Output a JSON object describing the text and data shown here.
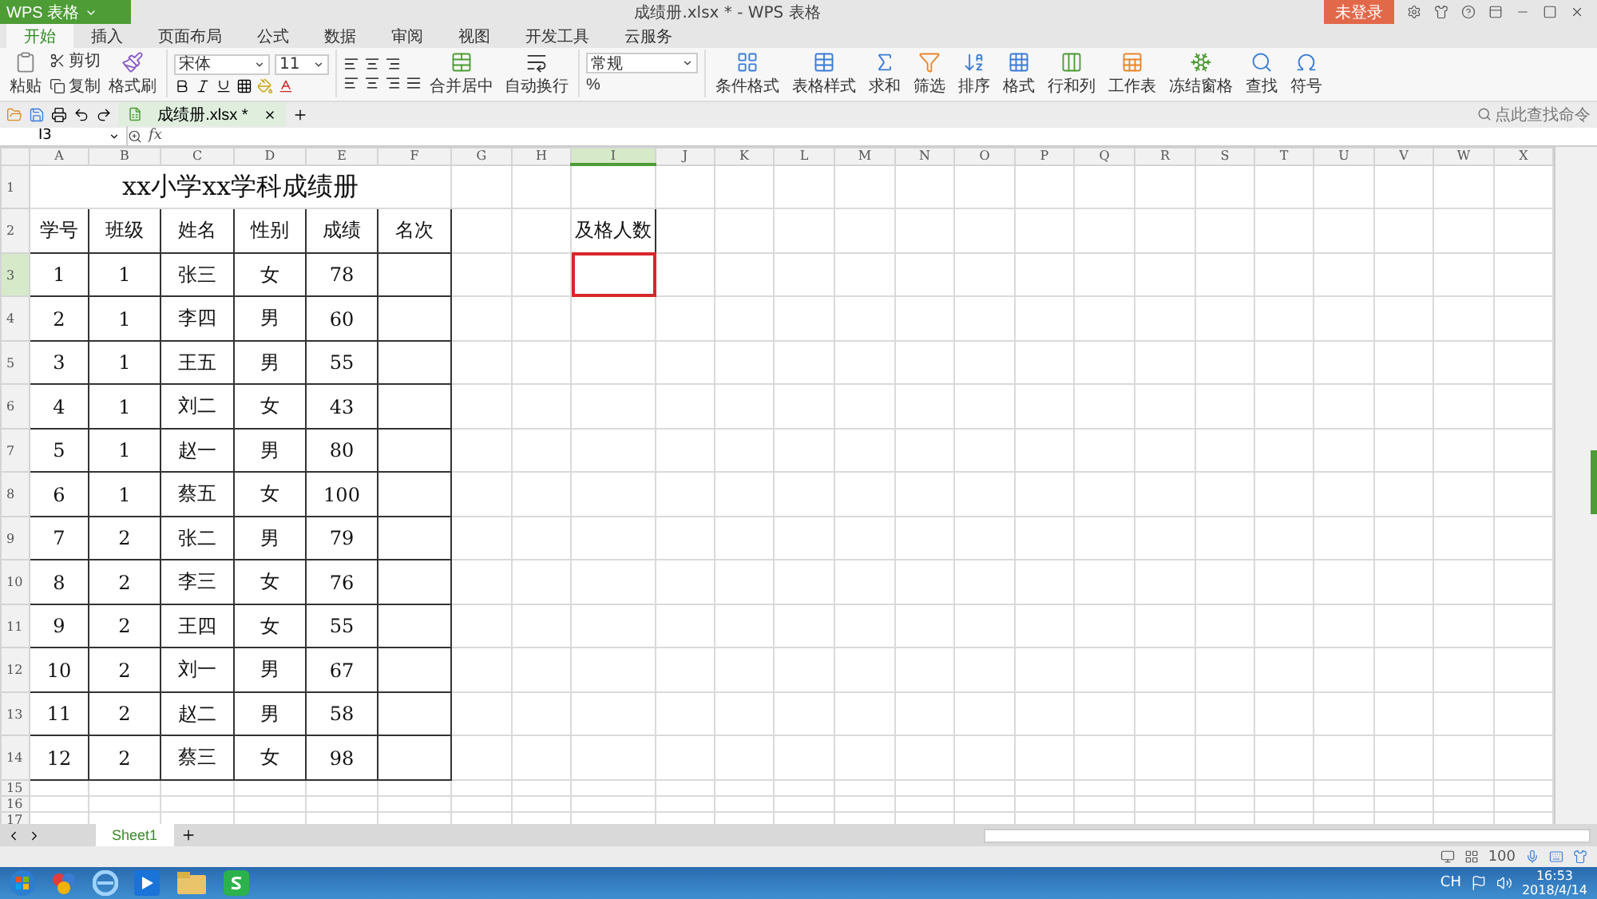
{
  "title_bar": {
    "app_menu": "WPS 表格",
    "title": "成绩册.xlsx * - WPS 表格",
    "login": "未登录"
  },
  "ribbon_tabs": [
    {
      "label": "开始",
      "selected": true
    },
    {
      "label": "插入",
      "selected": false
    },
    {
      "label": "页面布局",
      "selected": false
    },
    {
      "label": "公式",
      "selected": false
    },
    {
      "label": "数据",
      "selected": false
    },
    {
      "label": "审阅",
      "selected": false
    },
    {
      "label": "视图",
      "selected": false
    },
    {
      "label": "开发工具",
      "selected": false
    },
    {
      "label": "云服务",
      "selected": false
    }
  ],
  "ribbon": {
    "paste": "粘贴",
    "cut": "剪切",
    "copy": "复制",
    "format_painter": "格式刷",
    "font": "宋体",
    "font_size": "11",
    "merge": "合并居中",
    "wrap": "自动换行",
    "number_format": "常规",
    "percent": "%",
    "commands": [
      "条件格式",
      "表格样式",
      "求和",
      "筛选",
      "排序",
      "格式",
      "行和列",
      "工作表",
      "冻结窗格",
      "查找",
      "符号"
    ]
  },
  "doc_tabs": [
    {
      "label": "成绩册.xlsx *",
      "selected": true
    }
  ],
  "command_search": {
    "placeholder": "点此查找命令"
  },
  "formula_bar": {
    "cell_ref": "I3",
    "fx": "fx"
  },
  "sheet": {
    "columns": [
      {
        "label": "A",
        "selected": false
      },
      {
        "label": "B",
        "selected": false
      },
      {
        "label": "C",
        "selected": false
      },
      {
        "label": "D",
        "selected": false
      },
      {
        "label": "E",
        "selected": false
      },
      {
        "label": "F",
        "selected": false
      },
      {
        "label": "G",
        "selected": false
      },
      {
        "label": "H",
        "selected": false
      },
      {
        "label": "I",
        "selected": true
      },
      {
        "label": "J",
        "selected": false
      },
      {
        "label": "K",
        "selected": false
      },
      {
        "label": "L",
        "selected": false
      },
      {
        "label": "M",
        "selected": false
      },
      {
        "label": "N",
        "selected": false
      },
      {
        "label": "O",
        "selected": false
      },
      {
        "label": "P",
        "selected": false
      },
      {
        "label": "Q",
        "selected": false
      },
      {
        "label": "R",
        "selected": false
      },
      {
        "label": "S",
        "selected": false
      },
      {
        "label": "T",
        "selected": false
      },
      {
        "label": "U",
        "selected": false
      },
      {
        "label": "V",
        "selected": false
      },
      {
        "label": "W",
        "selected": false
      },
      {
        "label": "X",
        "selected": false
      }
    ],
    "rows": [
      {
        "number": "1",
        "selected": false
      },
      {
        "number": "2",
        "selected": false
      },
      {
        "number": "3",
        "selected": true
      },
      {
        "number": "4",
        "selected": false
      },
      {
        "number": "5",
        "selected": false
      },
      {
        "number": "6",
        "selected": false
      },
      {
        "number": "7",
        "selected": false
      },
      {
        "number": "8",
        "selected": false
      },
      {
        "number": "9",
        "selected": false
      },
      {
        "number": "10",
        "selected": false
      },
      {
        "number": "11",
        "selected": false
      },
      {
        "number": "12",
        "selected": false
      },
      {
        "number": "13",
        "selected": false
      },
      {
        "number": "14",
        "selected": false
      },
      {
        "number": "15",
        "selected": false
      },
      {
        "number": "16",
        "selected": false
      },
      {
        "number": "17",
        "selected": false
      }
    ],
    "title": "xx小学xx学科成绩册",
    "headers": [
      "学号",
      "班级",
      "姓名",
      "性别",
      "成绩",
      "名次"
    ],
    "records": [
      [
        "1",
        "1",
        "张三",
        "女",
        "78"
      ],
      [
        "2",
        "1",
        "李四",
        "男",
        "60"
      ],
      [
        "3",
        "1",
        "王五",
        "男",
        "55"
      ],
      [
        "4",
        "1",
        "刘二",
        "女",
        "43"
      ],
      [
        "5",
        "1",
        "赵一",
        "男",
        "80"
      ],
      [
        "6",
        "1",
        "蔡五",
        "女",
        "100"
      ],
      [
        "7",
        "2",
        "张二",
        "男",
        "79"
      ],
      [
        "8",
        "2",
        "李三",
        "女",
        "76"
      ],
      [
        "9",
        "2",
        "王四",
        "女",
        "55"
      ],
      [
        "10",
        "2",
        "刘一",
        "男",
        "67"
      ],
      [
        "11",
        "2",
        "赵二",
        "男",
        "58"
      ],
      [
        "12",
        "2",
        "蔡三",
        "女",
        "98"
      ]
    ],
    "side_label": "及格人数"
  },
  "sheet_tabs": [
    {
      "label": "Sheet1",
      "selected": true
    }
  ],
  "status_bar": {
    "zoom": "100"
  },
  "taskbar": {
    "language": "CH",
    "time": "16:53",
    "date": "2018/4/14"
  }
}
